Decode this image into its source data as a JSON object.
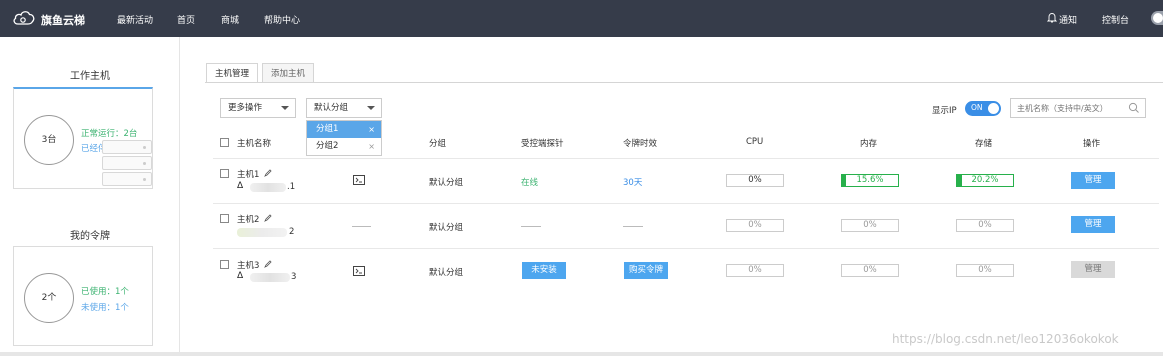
{
  "topbar": {
    "brand": "旗鱼云梯",
    "nav": [
      "最新活动",
      "首页",
      "商城",
      "帮助中心"
    ],
    "notify": "通知",
    "console": "控制台"
  },
  "sidebar": {
    "hosts_title": "工作主机",
    "hosts_count": "3台",
    "running": "正常运行：2台",
    "stopped": "已经停止：1台",
    "tokens_title": "我的令牌",
    "tokens_count": "2个",
    "used": "已使用：1个",
    "unused": "未使用：1个"
  },
  "tabs": [
    "主机管理",
    "添加主机"
  ],
  "toolbar": {
    "more_ops": "更多操作",
    "group_select": "默认分组",
    "dropdown": [
      "分组1",
      "分组2"
    ],
    "dropdown_close": "×",
    "show_ip": "显示IP",
    "ip_toggle": "ON",
    "search_placeholder": "主机名称（支持中/英文）"
  },
  "table": {
    "headers": [
      "主机名称",
      "分组",
      "受控端探针",
      "令牌时效",
      "CPU",
      "内存",
      "存储",
      "操作"
    ],
    "rows": [
      {
        "name": "主机1",
        "ip_suffix": ".1",
        "group": "默认分组",
        "probe": "在线",
        "token": "30天",
        "cpu": "0%",
        "mem": "15.6%",
        "mem_pct": 15.6,
        "disk": "20.2%",
        "disk_pct": 20.2,
        "action": "管理"
      },
      {
        "name": "主机2",
        "ip_suffix": "2",
        "group": "默认分组",
        "cpu": "0%",
        "mem": "0%",
        "disk": "0%",
        "action": "管理"
      },
      {
        "name": "主机3",
        "ip_suffix": "3",
        "group": "默认分组",
        "probe_btn": "未安装",
        "token_btn": "购买令牌",
        "cpu": "0%",
        "mem": "0%",
        "disk": "0%",
        "action": "管理"
      }
    ]
  },
  "watermark": "https://blog.csdn.net/leo12036okokok",
  "colors": {
    "topbar": "#363c4a",
    "accent": "#5aa6e8",
    "green": "#27b04b",
    "button": "#4da6ef"
  }
}
